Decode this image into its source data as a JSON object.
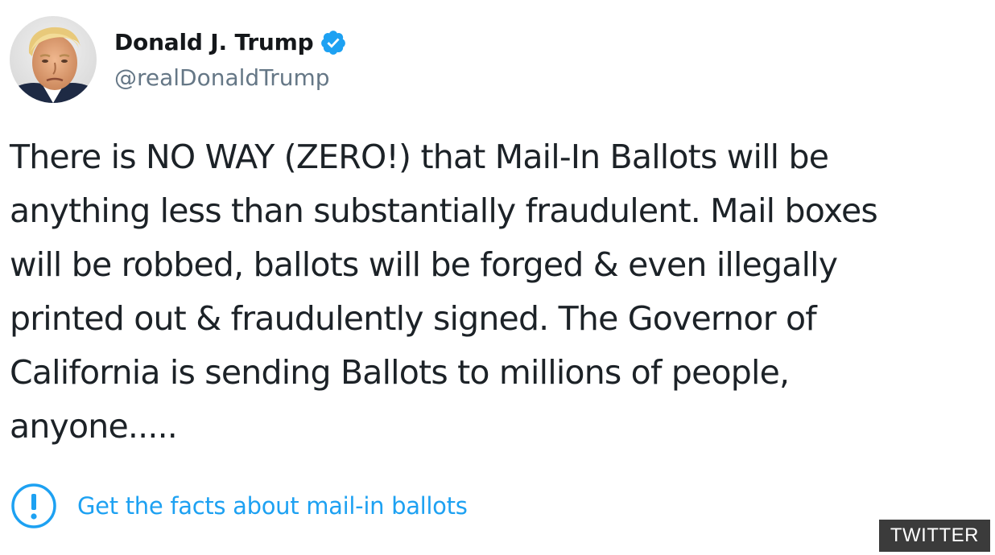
{
  "tweet": {
    "author": {
      "display_name": "Donald J. Trump",
      "handle": "@realDonaldTrump",
      "verified": true,
      "avatar_icon": "profile-photo",
      "verified_icon": "verified-badge-icon"
    },
    "text": "There is NO WAY (ZERO!) that Mail-In Ballots will be\nanything less than substantially fraudulent. Mail boxes\nwill be robbed, ballots will be forged & even illegally\nprinted out & fraudulently signed. The Governor of\nCalifornia is sending Ballots to millions of people,\nanyone.....",
    "fact_check": {
      "label": "Get the facts about mail-in ballots",
      "icon": "exclamation-circle-icon"
    }
  },
  "credit": {
    "label": "TWITTER"
  },
  "colors": {
    "link_blue": "#1da1f2",
    "verified_blue": "#1da1f2",
    "handle_gray": "#657786",
    "badge_bg": "#3b3b3b"
  }
}
